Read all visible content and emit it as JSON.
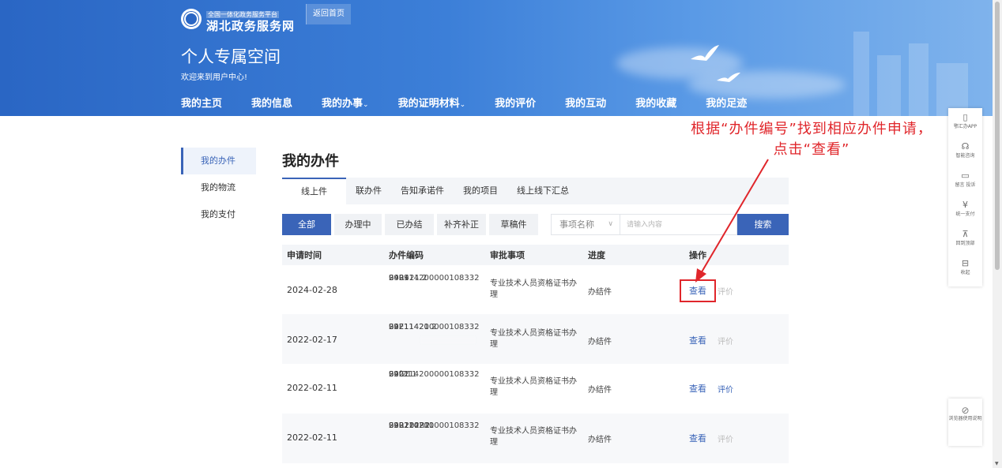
{
  "header": {
    "logo_small": "全国一体化政务服务平台",
    "logo_big": "湖北政务服务网",
    "back_home": "返回首页",
    "space_title": "个人专属空间",
    "space_subtitle": "欢迎来到用户中心!",
    "nav": [
      {
        "label": "我的主页"
      },
      {
        "label": "我的信息"
      },
      {
        "label": "我的办事",
        "caret": "⌄"
      },
      {
        "label": "我的证明材料",
        "caret": "⌄"
      },
      {
        "label": "我的评价"
      },
      {
        "label": "我的互动"
      },
      {
        "label": "我的收藏"
      },
      {
        "label": "我的足迹"
      }
    ]
  },
  "sidebar": {
    "items": [
      {
        "label": "我的办件"
      },
      {
        "label": "我的物流"
      },
      {
        "label": "我的支付"
      }
    ]
  },
  "main": {
    "title": "我的办件",
    "tabs": [
      {
        "label": "线上件"
      },
      {
        "label": "联办件"
      },
      {
        "label": "告知承诺件"
      },
      {
        "label": "我的项目"
      },
      {
        "label": "线上线下汇总"
      }
    ],
    "filters": [
      {
        "label": "全部"
      },
      {
        "label": "办理中"
      },
      {
        "label": "已办结"
      },
      {
        "label": "补齐补正"
      },
      {
        "label": "草稿件"
      }
    ],
    "select_value": "事项名称",
    "search_placeholder": "请输入内容",
    "search_label": "搜索",
    "table": {
      "headers": [
        "申请时间",
        "办件编码",
        "审批事项",
        "进度",
        "操作"
      ],
      "rows": [
        {
          "date": "2024-02-28",
          "code1": "S42114200000108332",
          "code2": "09R421                    2",
          "code3": "2409",
          "item": "专业技术人员资格证书办理",
          "progress": "办结件",
          "view": "查看",
          "rate": "评价"
        },
        {
          "date": "2022-02-17",
          "code1": "S42114200000108332",
          "code2": "09E11421                  2",
          "code3": "2221",
          "item": "专业技术人员资格证书办理",
          "progress": "办结件",
          "view": "查看",
          "rate": "评价"
        },
        {
          "date": "2022-02-11",
          "code1": "S42114200000108332",
          "code2": "09f211",
          "code3": "2202",
          "item": "专业技术人员资格证书办理",
          "progress": "办结件",
          "view": "查看",
          "rate": "评价"
        },
        {
          "date": "2022-02-11",
          "code1": "S42114200000108332",
          "code2": "09R202R2",
          "code3": "220220211",
          "item": "专业技术人员资格证书办理",
          "progress": "办结件",
          "view": "查看",
          "rate": "评价"
        }
      ]
    }
  },
  "annotation": {
    "text": "根据“办件编号”找到相应办件申请，点击“查看”",
    "color": "#e0262b"
  },
  "tools": [
    {
      "icon": "phone-icon",
      "glyph": "▯",
      "label": "鄂汇办APP"
    },
    {
      "icon": "headset-icon",
      "glyph": "☊",
      "label": "智能咨询"
    },
    {
      "icon": "message-icon",
      "glyph": "▭",
      "label": "留言 投诉"
    },
    {
      "icon": "yuan-icon",
      "glyph": "¥",
      "label": "统一支付"
    },
    {
      "icon": "to-top-icon",
      "glyph": "⊼",
      "label": "回到顶部"
    },
    {
      "icon": "collapse-icon",
      "glyph": "⊟",
      "label": "收起"
    }
  ],
  "browser_tip": {
    "icon": "browser-icon",
    "glyph": "⊘",
    "label": "浏览器使用说明"
  },
  "colors": {
    "accent": "#3a64b8",
    "banner": "#2a66c4",
    "annotation": "#e0262b"
  }
}
